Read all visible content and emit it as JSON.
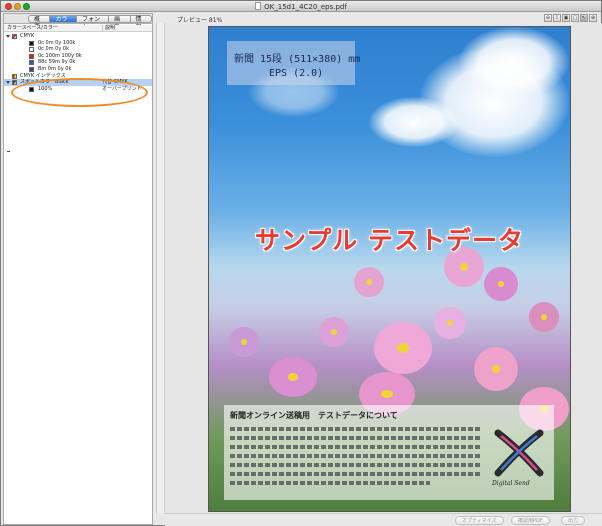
{
  "window": {
    "title": "OK_15d1_4C20_eps.pdf"
  },
  "tabs": [
    {
      "label": "概要",
      "active": false
    },
    {
      "label": "カラー",
      "active": true
    },
    {
      "label": "フォント",
      "active": false
    },
    {
      "label": "画像",
      "active": false
    },
    {
      "label": "情報",
      "active": false
    }
  ],
  "color_list": {
    "columns": [
      "カラースペース/カラー",
      "説明"
    ],
    "items": [
      {
        "label": "CMYK",
        "type": "group"
      },
      {
        "label": "0c 0m 0y 100k",
        "swatch": "#111111",
        "desc": ""
      },
      {
        "label": "0c 0m 0y 0k",
        "swatch": "#ffffff",
        "desc": ""
      },
      {
        "label": "0c 100m 100y 0k",
        "swatch": "#e21b1b",
        "desc": ""
      },
      {
        "label": "88c 59m 9y 0k",
        "swatch": "#2d5ea8",
        "desc": ""
      },
      {
        "label": "Bm 0m 0y 0k",
        "swatch": "#2f49b8",
        "desc": ""
      },
      {
        "label": "CMYK インデックス",
        "type": "group"
      },
      {
        "label": "スポットカラーBlack",
        "type": "group",
        "desc": "代替 CMYK",
        "selected": true
      },
      {
        "label": "100%",
        "swatch": "#111111",
        "desc": "オーバープリント"
      }
    ]
  },
  "preview": {
    "label": "プレビュー 81%",
    "toolbar_icons": [
      "zoom-out-icon",
      "text-cursor-icon",
      "fit-page-icon",
      "single-page-icon",
      "pointer-icon",
      "zoom-in-icon"
    ]
  },
  "page": {
    "spec_line1": "新聞 15段 (511×380) mm",
    "spec_line2": "EPS (2.0)",
    "sample_text": "サンプル テストデータ",
    "box_title": "新聞オンライン送稿用　テストデータについて",
    "logo_text": "Digital Send"
  },
  "buttons": {
    "optimize": "オプティマイズ",
    "proof_pdf": "確認用PDF",
    "output": "出力"
  }
}
